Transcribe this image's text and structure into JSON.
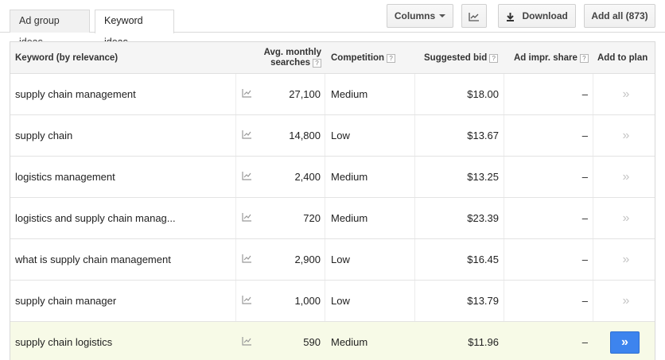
{
  "tabs": [
    {
      "label": "Ad group ideas"
    },
    {
      "label": "Keyword ideas"
    }
  ],
  "toolbar": {
    "columns_label": "Columns",
    "download_label": "Download",
    "add_all_label": "Add all (873)"
  },
  "table": {
    "headers": {
      "keyword": "Keyword (by relevance)",
      "avg_line1": "Avg. monthly",
      "avg_line2": "searches",
      "competition": "Competition",
      "bid": "Suggested bid",
      "impr": "Ad impr. share",
      "add": "Add to plan",
      "help": "?"
    },
    "rows": [
      {
        "keyword": "supply chain management",
        "avg": "27,100",
        "competition": "Medium",
        "bid": "$18.00",
        "impr": "–",
        "add": "»"
      },
      {
        "keyword": "supply chain",
        "avg": "14,800",
        "competition": "Low",
        "bid": "$13.67",
        "impr": "–",
        "add": "»"
      },
      {
        "keyword": "logistics management",
        "avg": "2,400",
        "competition": "Medium",
        "bid": "$13.25",
        "impr": "–",
        "add": "»"
      },
      {
        "keyword": "logistics and supply chain manag...",
        "avg": "720",
        "competition": "Medium",
        "bid": "$23.39",
        "impr": "–",
        "add": "»"
      },
      {
        "keyword": "what is supply chain management",
        "avg": "2,900",
        "competition": "Low",
        "bid": "$16.45",
        "impr": "–",
        "add": "»"
      },
      {
        "keyword": "supply chain manager",
        "avg": "1,000",
        "competition": "Low",
        "bid": "$13.79",
        "impr": "–",
        "add": "»"
      },
      {
        "keyword": "supply chain logistics",
        "avg": "590",
        "competition": "Medium",
        "bid": "$11.96",
        "impr": "–",
        "add": "»"
      }
    ]
  },
  "icons": {
    "trend": "trend-chart-icon",
    "download": "download-icon",
    "columns": "chevron-down-icon"
  },
  "colors": {
    "highlight_row": "#f7fae7",
    "add_button": "#3d84ee"
  }
}
